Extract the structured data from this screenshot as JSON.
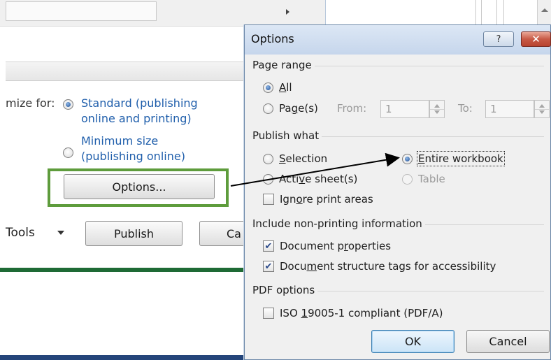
{
  "background": {
    "optimize_label": "mize for:",
    "standard_option": "Standard (publishing online and printing)",
    "standard_line1": "Standard (publishing",
    "standard_line2": "online and printing)",
    "minimum_line1": "Minimum size",
    "minimum_line2": "(publishing online)",
    "options_button": "Options...",
    "tools_label": "Tools",
    "publish_button": "Publish",
    "cancel_button_partial": "Ca"
  },
  "dialog": {
    "title": "Options",
    "help_label": "?",
    "close_label": "✕",
    "page_range": {
      "heading": "Page range",
      "all": {
        "pre": "",
        "accel": "A",
        "post": "ll"
      },
      "pages": {
        "pre": "Pa",
        "accel": "g",
        "post": "e(s)"
      },
      "from_label": "From:",
      "from_value": "1",
      "to_label": "To:",
      "to_value": "1"
    },
    "publish_what": {
      "heading": "Publish what",
      "selection": {
        "pre": "",
        "accel": "S",
        "post": "election"
      },
      "entire_workbook": {
        "pre": "",
        "accel": "E",
        "post": "ntire workbook"
      },
      "active_sheets": {
        "pre": "Acti",
        "accel": "v",
        "post": "e sheet(s)"
      },
      "table": "Table",
      "ignore_print_areas": {
        "pre": "Ign",
        "accel": "o",
        "post": "re print areas"
      }
    },
    "non_printing": {
      "heading": "Include non-printing information",
      "doc_properties": {
        "pre": "Document p",
        "accel": "r",
        "post": "operties"
      },
      "doc_structure": {
        "pre": "Docu",
        "accel": "m",
        "post": "ent structure tags for accessibility"
      }
    },
    "pdf_options": {
      "heading": "PDF options",
      "iso": {
        "pre": "ISO ",
        "accel": "1",
        "post": "9005-1 compliant (PDF/A)"
      }
    },
    "ok_button": "OK",
    "cancel_button": "Cancel"
  },
  "colors": {
    "highlight_box": "#5e9c3c",
    "link_text": "#1f5eab",
    "arrow": "#000000"
  },
  "icons": {
    "help": "question-mark-icon",
    "close": "close-icon",
    "arrow": "arrow-annotation-icon"
  }
}
